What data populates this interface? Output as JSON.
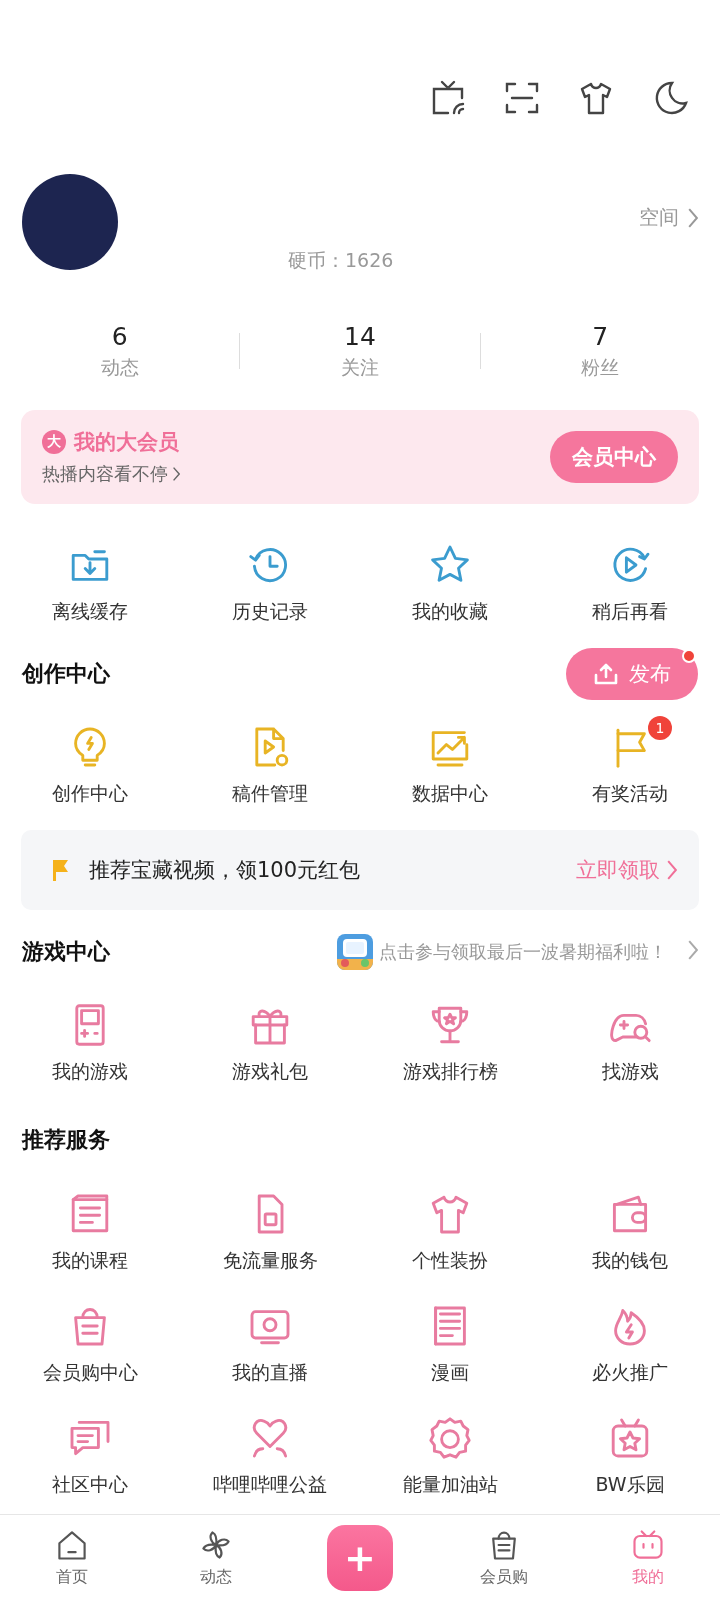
{
  "profile": {
    "coins": "硬币：1626",
    "space_link": "空间"
  },
  "stats": [
    {
      "value": "6",
      "label": "动态"
    },
    {
      "value": "14",
      "label": "关注"
    },
    {
      "value": "7",
      "label": "粉丝"
    }
  ],
  "vip": {
    "badge": "大",
    "title": "我的大会员",
    "subtitle": "热播内容看不停",
    "button": "会员中心"
  },
  "quick_actions": [
    "离线缓存",
    "历史记录",
    "我的收藏",
    "稍后再看"
  ],
  "creator": {
    "title": "创作中心",
    "publish_button": "发布",
    "publish_dot": true,
    "items": [
      {
        "label": "创作中心"
      },
      {
        "label": "稿件管理"
      },
      {
        "label": "数据中心"
      },
      {
        "label": "有奖活动",
        "badge": "1"
      }
    ]
  },
  "banner": {
    "text": "推荐宝藏视频，领100元红包",
    "action": "立即领取"
  },
  "games": {
    "title": "游戏中心",
    "promo": "点击参与领取最后一波暑期福利啦！",
    "items": [
      "我的游戏",
      "游戏礼包",
      "游戏排行榜",
      "找游戏"
    ]
  },
  "services": {
    "title": "推荐服务",
    "items": [
      "我的课程",
      "免流量服务",
      "个性装扮",
      "我的钱包",
      "会员购中心",
      "我的直播",
      "漫画",
      "必火推广",
      "社区中心",
      "哔哩哔哩公益",
      "能量加油站",
      "BW乐园"
    ]
  },
  "nav": [
    {
      "label": "首页",
      "selected": false
    },
    {
      "label": "动态",
      "selected": false
    },
    {
      "label": "+",
      "kind": "publish"
    },
    {
      "label": "会员购",
      "selected": false
    },
    {
      "label": "我的",
      "selected": true
    }
  ]
}
